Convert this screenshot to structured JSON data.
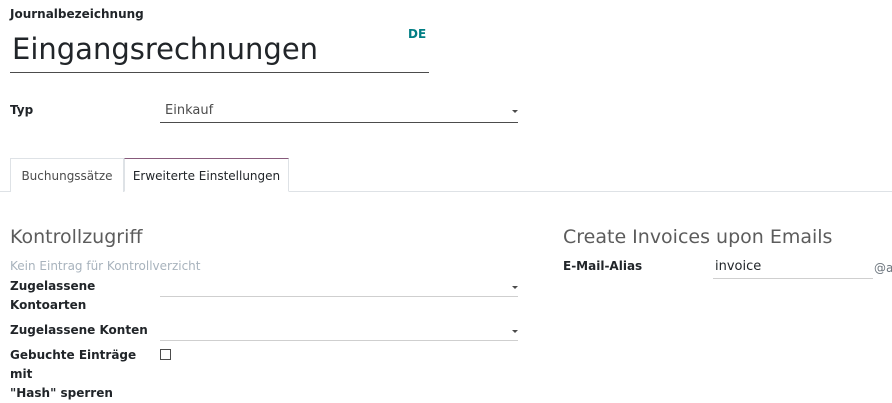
{
  "journal": {
    "name_label": "Journalbezeichnung",
    "name_value": "Eingangsrechnungen",
    "lang_badge": "DE",
    "type_label": "Typ",
    "type_value": "Einkauf"
  },
  "tabs": [
    {
      "label": "Buchungssätze",
      "active": false
    },
    {
      "label": "Erweiterte Einstellungen",
      "active": true
    }
  ],
  "control_access": {
    "title": "Kontrollzugriff",
    "empty_note": "Kein Eintrag für Kontrollverzicht",
    "allowed_account_types_label_line1": "Zugelassene",
    "allowed_account_types_label_line2": "Kontoarten",
    "allowed_accounts_label": "Zugelassene Konten",
    "lock_hash_label_line1": "Gebuchte Einträge mit",
    "lock_hash_label_line2": "\"Hash\" sperren",
    "lock_hash_checked": false
  },
  "emails": {
    "title": "Create Invoices upon Emails",
    "alias_label": "E-Mail-Alias",
    "alias_value": "invoice",
    "alias_domain": "@a"
  },
  "colors": {
    "accent": "#017e84",
    "active_tab_border": "#875a7b"
  }
}
